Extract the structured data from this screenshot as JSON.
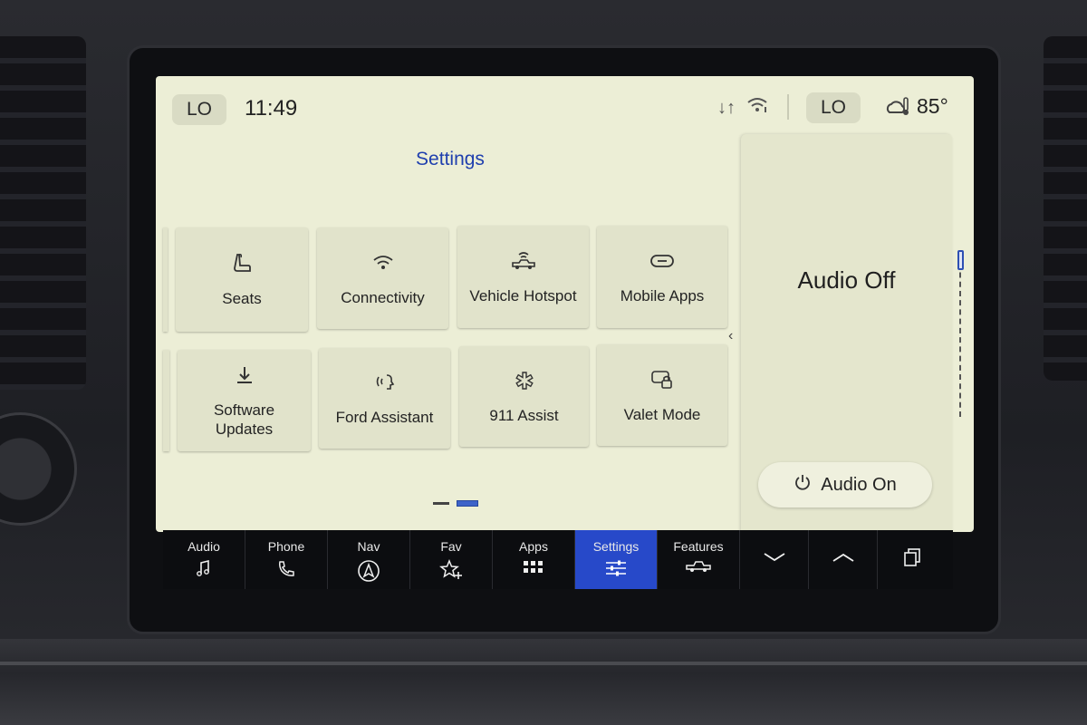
{
  "status_bar": {
    "climate_left": "LO",
    "clock": "11:49",
    "climate_right": "LO",
    "temperature": "85°"
  },
  "page_title": "Settings",
  "tiles": [
    {
      "label": "Seats",
      "icon": "seat-icon"
    },
    {
      "label": "Connectivity",
      "icon": "wifi-icon"
    },
    {
      "label": "Vehicle Hotspot",
      "icon": "vehicle-hotspot-icon"
    },
    {
      "label": "Mobile Apps",
      "icon": "link-icon"
    },
    {
      "label": "Software\nUpdates",
      "icon": "download-icon"
    },
    {
      "label": "Ford Assistant",
      "icon": "voice-assistant-icon"
    },
    {
      "label": "911 Assist",
      "icon": "emergency-icon"
    },
    {
      "label": "Valet Mode",
      "icon": "valet-lock-icon"
    }
  ],
  "pager": {
    "pages": 2,
    "current": 2
  },
  "audio_panel": {
    "status": "Audio Off",
    "on_button": "Audio On"
  },
  "nav": [
    {
      "label": "Audio",
      "icon": "music-note-icon"
    },
    {
      "label": "Phone",
      "icon": "phone-icon"
    },
    {
      "label": "Nav",
      "icon": "navigation-icon"
    },
    {
      "label": "Fav",
      "icon": "star-plus-icon"
    },
    {
      "label": "Apps",
      "icon": "apps-grid-icon"
    },
    {
      "label": "Settings",
      "icon": "sliders-icon",
      "active": true
    },
    {
      "label": "Features",
      "icon": "truck-icon"
    }
  ],
  "colors": {
    "screen_bg": "#eceed6",
    "accent": "#2749c9",
    "title_blue": "#1f3fae"
  }
}
